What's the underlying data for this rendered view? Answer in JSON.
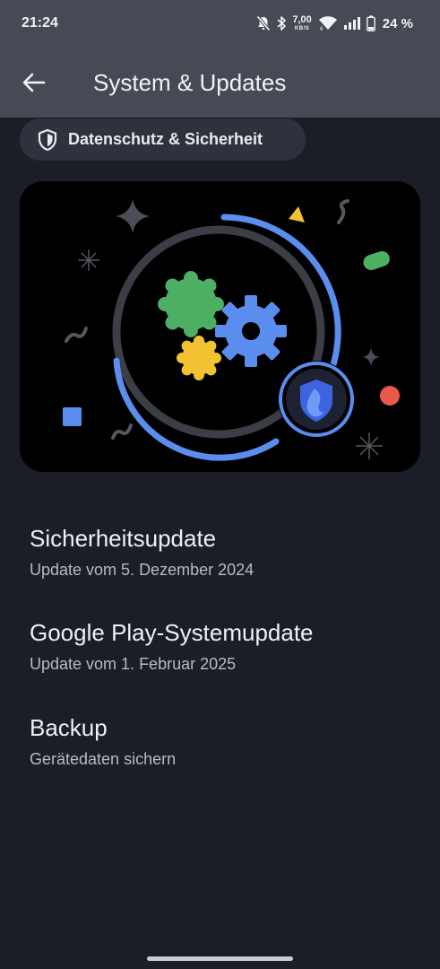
{
  "status_bar": {
    "time": "21:24",
    "net_speed_value": "7,00",
    "net_speed_unit": "KB/S",
    "battery_percent": "24 %",
    "icons": [
      "mute-bell-icon",
      "bluetooth-icon",
      "wifi-icon",
      "signal-icon",
      "battery-icon"
    ]
  },
  "app_bar": {
    "title": "System & Updates",
    "back_icon": "arrow-left-icon"
  },
  "chip": {
    "label": "Datenschutz & Sicherheit",
    "icon": "shield-icon"
  },
  "hero": {
    "icons": [
      "gear-icon",
      "shield-icon"
    ],
    "colors": {
      "blue": "#5b8def",
      "green": "#4caf62",
      "yellow": "#f3c231",
      "red": "#e8584b",
      "ring": "#3a3d44"
    }
  },
  "items": [
    {
      "title": "Sicherheitsupdate",
      "subtitle": "Update vom 5. Dezember 2024"
    },
    {
      "title": "Google Play-Systemupdate",
      "subtitle": "Update vom 1. Februar 2025"
    },
    {
      "title": "Backup",
      "subtitle": "Gerätedaten sichern"
    }
  ]
}
